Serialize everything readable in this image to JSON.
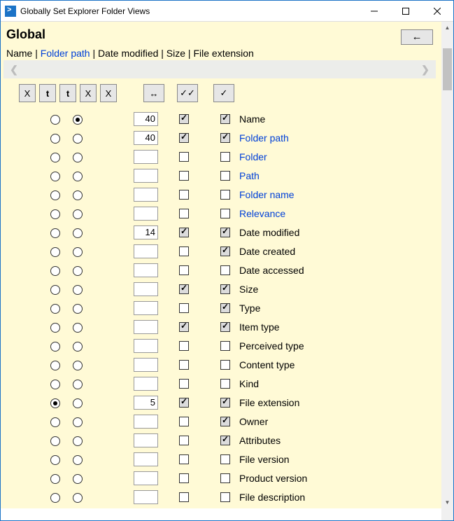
{
  "window": {
    "title": "Globally Set Explorer Folder Views"
  },
  "heading": "Global",
  "back_button": "←",
  "columns_line": {
    "prefix": "Name | ",
    "link": "Folder path",
    "suffix": " | Date modified | Size | File extension"
  },
  "header_buttons": {
    "b1": "X",
    "b2": "t",
    "b3": "t",
    "b4": "X",
    "b5": "X",
    "width": "↔",
    "check_all": "✓✓",
    "check_one": "✓"
  },
  "rows": [
    {
      "r1": false,
      "r2": true,
      "width": "40",
      "c1": true,
      "c2": true,
      "label": "Name",
      "link": false
    },
    {
      "r1": false,
      "r2": false,
      "width": "40",
      "c1": true,
      "c2": true,
      "label": "Folder path",
      "link": true
    },
    {
      "r1": false,
      "r2": false,
      "width": "",
      "c1": false,
      "c2": false,
      "label": "Folder",
      "link": true
    },
    {
      "r1": false,
      "r2": false,
      "width": "",
      "c1": false,
      "c2": false,
      "label": "Path",
      "link": true
    },
    {
      "r1": false,
      "r2": false,
      "width": "",
      "c1": false,
      "c2": false,
      "label": "Folder name",
      "link": true
    },
    {
      "r1": false,
      "r2": false,
      "width": "",
      "c1": false,
      "c2": false,
      "label": "Relevance",
      "link": true
    },
    {
      "r1": false,
      "r2": false,
      "width": "14",
      "c1": true,
      "c2": true,
      "label": "Date modified",
      "link": false
    },
    {
      "r1": false,
      "r2": false,
      "width": "",
      "c1": false,
      "c2": true,
      "label": "Date created",
      "link": false
    },
    {
      "r1": false,
      "r2": false,
      "width": "",
      "c1": false,
      "c2": false,
      "label": "Date accessed",
      "link": false
    },
    {
      "r1": false,
      "r2": false,
      "width": "",
      "c1": true,
      "c2": true,
      "label": "Size",
      "link": false
    },
    {
      "r1": false,
      "r2": false,
      "width": "",
      "c1": false,
      "c2": true,
      "label": "Type",
      "link": false
    },
    {
      "r1": false,
      "r2": false,
      "width": "",
      "c1": true,
      "c2": true,
      "label": "Item type",
      "link": false
    },
    {
      "r1": false,
      "r2": false,
      "width": "",
      "c1": false,
      "c2": false,
      "label": "Perceived type",
      "link": false
    },
    {
      "r1": false,
      "r2": false,
      "width": "",
      "c1": false,
      "c2": false,
      "label": "Content type",
      "link": false
    },
    {
      "r1": false,
      "r2": false,
      "width": "",
      "c1": false,
      "c2": false,
      "label": "Kind",
      "link": false
    },
    {
      "r1": true,
      "r2": false,
      "width": "5",
      "c1": true,
      "c2": true,
      "label": "File extension",
      "link": false
    },
    {
      "r1": false,
      "r2": false,
      "width": "",
      "c1": false,
      "c2": true,
      "label": "Owner",
      "link": false
    },
    {
      "r1": false,
      "r2": false,
      "width": "",
      "c1": false,
      "c2": true,
      "label": "Attributes",
      "link": false
    },
    {
      "r1": false,
      "r2": false,
      "width": "",
      "c1": false,
      "c2": false,
      "label": "File version",
      "link": false
    },
    {
      "r1": false,
      "r2": false,
      "width": "",
      "c1": false,
      "c2": false,
      "label": "Product version",
      "link": false
    },
    {
      "r1": false,
      "r2": false,
      "width": "",
      "c1": false,
      "c2": false,
      "label": "File description",
      "link": false
    }
  ]
}
